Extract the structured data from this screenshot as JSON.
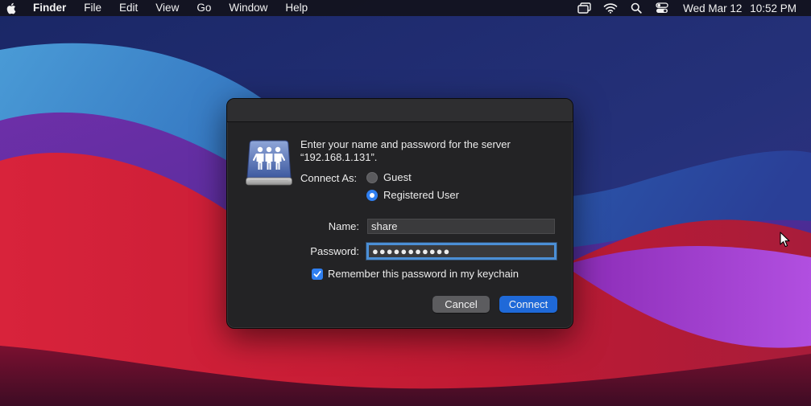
{
  "menubar": {
    "app_name": "Finder",
    "items": [
      "File",
      "Edit",
      "View",
      "Go",
      "Window",
      "Help"
    ],
    "status_icons": [
      "screen-mirroring-icon",
      "wifi-icon",
      "spotlight-search-icon",
      "control-center-icon"
    ],
    "clock": {
      "date": "Wed Mar 12",
      "time": "10:52 PM"
    }
  },
  "dialog": {
    "icon": "shared-server-icon",
    "prompt_line1": "Enter your name and password for the server",
    "prompt_line2": "“192.168.1.131”.",
    "connect_as_label": "Connect As:",
    "options": [
      {
        "label": "Guest",
        "selected": false
      },
      {
        "label": "Registered User",
        "selected": true
      }
    ],
    "name_label": "Name:",
    "name_value": "share",
    "password_label": "Password:",
    "password_value": "●●●●●●●●●●●",
    "remember_label": "Remember this password in my keychain",
    "remember_checked": true,
    "cancel_label": "Cancel",
    "connect_label": "Connect"
  },
  "colors": {
    "accent": "#2f7ff0",
    "dialog_bg": "#232325",
    "focus_ring": "#4b8fd6",
    "wallpaper_blue": "#1e2a6e",
    "wallpaper_red": "#c41d34",
    "wallpaper_purple": "#9b3ec9"
  }
}
